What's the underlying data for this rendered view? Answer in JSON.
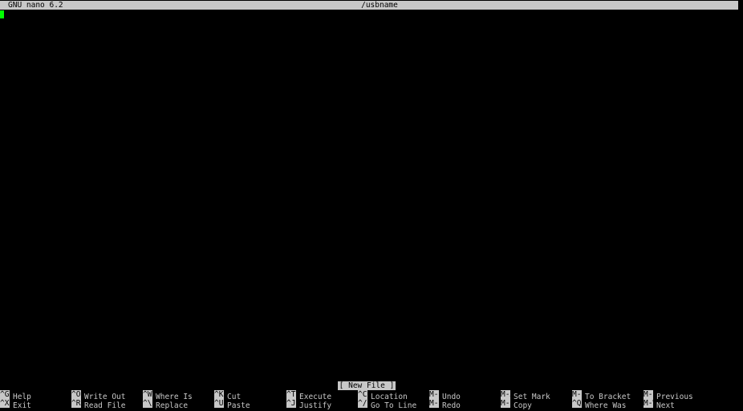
{
  "titlebar": {
    "app": "GNU nano 6.2",
    "filename": "/usbname"
  },
  "status": {
    "message": "[ New File ]"
  },
  "colors": {
    "background": "#000000",
    "bar": "#c8c8c8",
    "text": "#c8c8c8",
    "cursor": "#00ff00"
  },
  "shortcuts": [
    [
      {
        "key": "^G",
        "label": "Help"
      },
      {
        "key": "^O",
        "label": "Write Out"
      },
      {
        "key": "^W",
        "label": "Where Is"
      },
      {
        "key": "^K",
        "label": "Cut"
      },
      {
        "key": "^T",
        "label": "Execute"
      },
      {
        "key": "^C",
        "label": "Location"
      },
      {
        "key": "M-U",
        "label": "Undo"
      },
      {
        "key": "M-A",
        "label": "Set Mark"
      },
      {
        "key": "M-]",
        "label": "To Bracket"
      },
      {
        "key": "M-Q",
        "label": "Previous"
      }
    ],
    [
      {
        "key": "^X",
        "label": "Exit"
      },
      {
        "key": "^R",
        "label": "Read File"
      },
      {
        "key": "^\\",
        "label": "Replace"
      },
      {
        "key": "^U",
        "label": "Paste"
      },
      {
        "key": "^J",
        "label": "Justify"
      },
      {
        "key": "^/",
        "label": "Go To Line"
      },
      {
        "key": "M-E",
        "label": "Redo"
      },
      {
        "key": "M-6",
        "label": "Copy"
      },
      {
        "key": "^Q",
        "label": "Where Was"
      },
      {
        "key": "M-W",
        "label": "Next"
      }
    ]
  ]
}
